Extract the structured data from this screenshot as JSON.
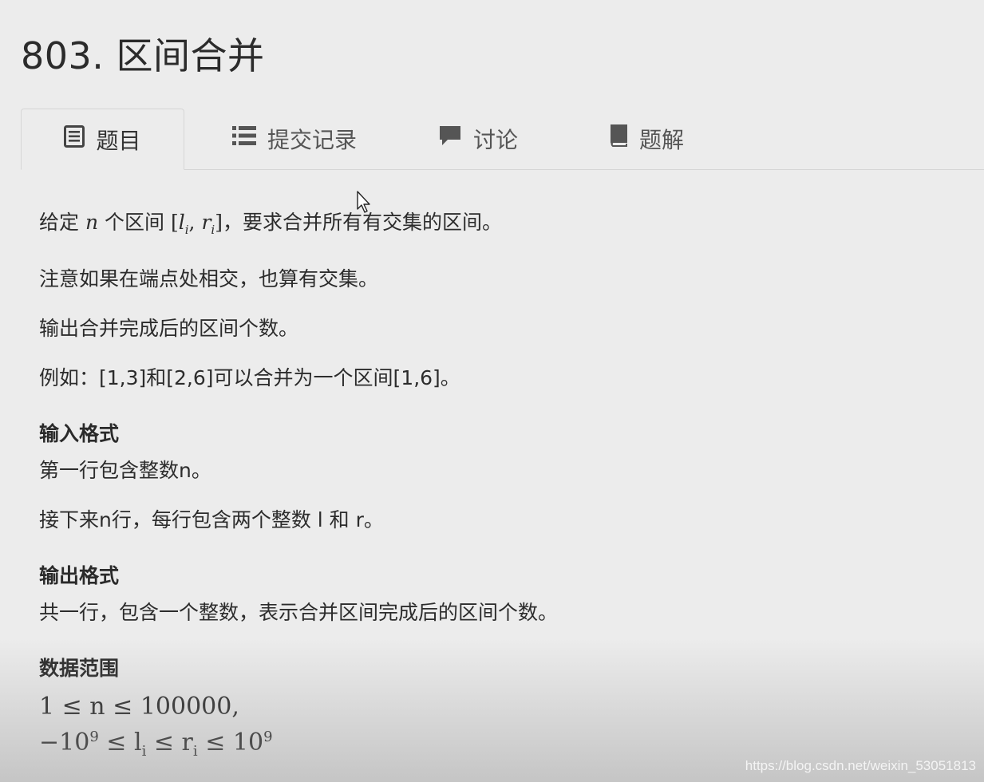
{
  "problem": {
    "title": "803. 区间合并"
  },
  "tabs": [
    {
      "label": "题目",
      "icon": "list-doc-icon",
      "active": true
    },
    {
      "label": "提交记录",
      "icon": "list-icon",
      "active": false
    },
    {
      "label": "讨论",
      "icon": "comment-icon",
      "active": false
    },
    {
      "label": "题解",
      "icon": "book-icon",
      "active": false
    }
  ],
  "description": {
    "line1_pre": "给定 ",
    "line1_var": "n",
    "line1_mid": " 个区间 ",
    "line1_l": "l",
    "line1_sub": "i",
    "line1_comma": ", ",
    "line1_r": "r",
    "line1_post": "，要求合并所有有交集的区间。",
    "line2": "注意如果在端点处相交，也算有交集。",
    "line3": "输出合并完成后的区间个数。",
    "line4": "例如：[1,3]和[2,6]可以合并为一个区间[1,6]。"
  },
  "input_format": {
    "title": "输入格式",
    "line1": "第一行包含整数n。",
    "line2": "接下来n行，每行包含两个整数 l 和 r。"
  },
  "output_format": {
    "title": "输出格式",
    "line1": "共一行，包含一个整数，表示合并区间完成后的区间个数。"
  },
  "data_range": {
    "title": "数据范围",
    "line1": "1 ≤ n ≤ 100000,",
    "line2_a": "−10",
    "line2_exp": "9",
    "line2_b": " ≤ l",
    "line2_sub1": "i",
    "line2_c": " ≤ r",
    "line2_sub2": "i",
    "line2_d": " ≤ 10",
    "line2_exp2": "9"
  },
  "watermark": "https://blog.csdn.net/weixin_53051813"
}
